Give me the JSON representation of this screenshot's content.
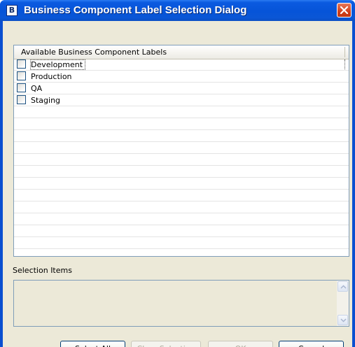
{
  "window": {
    "title": "Business Component Label Selection Dialog",
    "icon": "app-icon",
    "icon_glyph": "B",
    "close_icon": "close-icon",
    "accent": "#0a4fd0"
  },
  "labels_list": {
    "header": "Available Business Component Labels",
    "items": [
      {
        "label": "Development",
        "checked": false
      },
      {
        "label": "Production",
        "checked": false
      },
      {
        "label": "QA",
        "checked": false
      },
      {
        "label": "Staging",
        "checked": false
      }
    ]
  },
  "selection": {
    "label": "Selection Items",
    "items": []
  },
  "buttons": {
    "select_all": "Select All",
    "clear_selection": "Clear Selection",
    "ok": "OK",
    "cancel": "Cancel"
  }
}
